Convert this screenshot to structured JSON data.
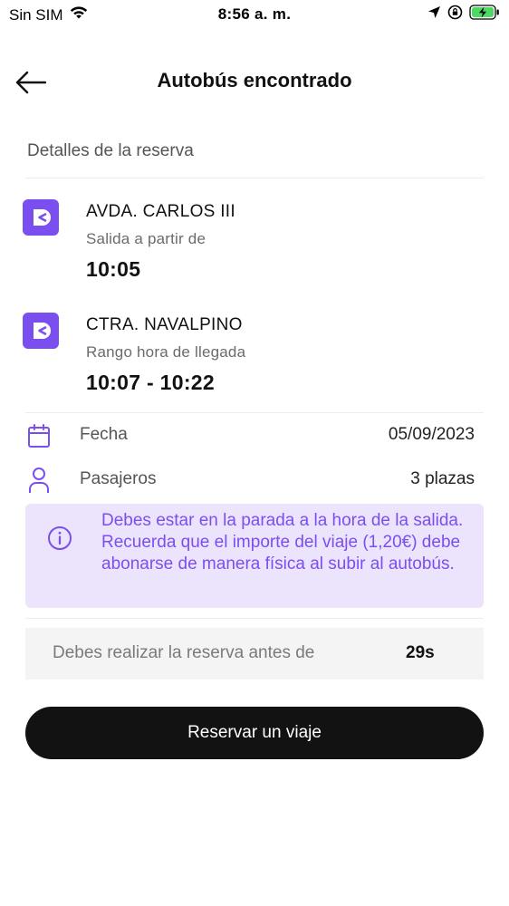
{
  "status_bar": {
    "carrier": "Sin SIM",
    "time": "8:56 a. m.",
    "icons": [
      "wifi-icon",
      "location-arrow-icon",
      "orientation-lock-icon",
      "battery-charging-icon"
    ]
  },
  "header": {
    "back_icon": "arrow-left-icon",
    "title": "Autobús encontrado"
  },
  "details": {
    "section_title": "Detalles de la reserva",
    "origin": {
      "icon": "bus-stop-icon",
      "name": "AVDA. CARLOS III",
      "subtitle": "Salida a partir de",
      "time": "10:05"
    },
    "destination": {
      "icon": "bus-stop-icon",
      "name": "CTRA. NAVALPINO",
      "subtitle": "Rango hora de llegada",
      "time": "10:07 - 10:22"
    },
    "date": {
      "icon": "calendar-icon",
      "label": "Fecha",
      "value": "05/09/2023"
    },
    "passengers": {
      "icon": "person-icon",
      "label": "Pasajeros",
      "value": "3 plazas"
    }
  },
  "notice": {
    "icon": "info-icon",
    "text": "Debes estar en la parada a la hora de la salida. Recuerda que el importe del viaje (1,20€) debe abonarse de manera física al subir al autobús."
  },
  "countdown": {
    "label": "Debes realizar la reserva antes de",
    "value": "29s"
  },
  "actions": {
    "reserve_label": "Reservar un viaje"
  },
  "colors": {
    "accent": "#7b4ef0",
    "notice_bg": "#ece4fd",
    "button_bg": "#121212",
    "countdown_bg": "#f4f4f4"
  }
}
